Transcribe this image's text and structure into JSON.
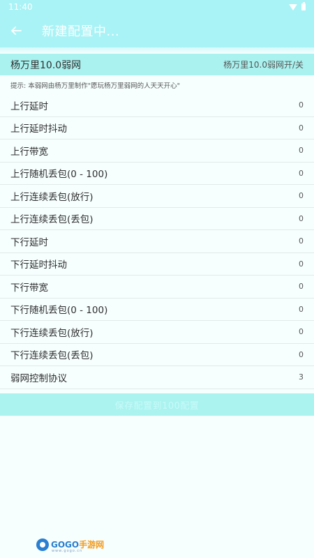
{
  "status_bar": {
    "time": "11:40"
  },
  "app_bar": {
    "back_icon": "arrow-left-icon",
    "title": "新建配置中..."
  },
  "profile": {
    "name": "杨万里10.0弱网",
    "toggle_label": "杨万里10.0弱网开/关"
  },
  "hint": "提示: 本弱网由杨万里制作\"愿玩杨万里弱网的人天天开心\"",
  "settings": [
    {
      "label": "上行延时",
      "value": "0"
    },
    {
      "label": "上行延时抖动",
      "value": "0"
    },
    {
      "label": "上行带宽",
      "value": "0"
    },
    {
      "label": "上行随机丢包(0 - 100)",
      "value": "0"
    },
    {
      "label": "上行连续丢包(放行)",
      "value": "0"
    },
    {
      "label": "上行连续丢包(丢包)",
      "value": "0"
    },
    {
      "label": "下行延时",
      "value": "0"
    },
    {
      "label": "下行延时抖动",
      "value": "0"
    },
    {
      "label": "下行带宽",
      "value": "0"
    },
    {
      "label": "下行随机丢包(0 - 100)",
      "value": "0"
    },
    {
      "label": "下行连续丢包(放行)",
      "value": "0"
    },
    {
      "label": "下行连续丢包(丢包)",
      "value": "0"
    },
    {
      "label": "弱网控制协议",
      "value": "3"
    }
  ],
  "save_button": {
    "label": "保存配置到100配置"
  },
  "watermark": {
    "brand_a": "GOGO",
    "brand_b": "手游网",
    "domain": "www.gogo.cn"
  },
  "colors": {
    "accent": "#a9f3f6",
    "header_row": "#aaf2ef",
    "background": "#f6fefe"
  }
}
